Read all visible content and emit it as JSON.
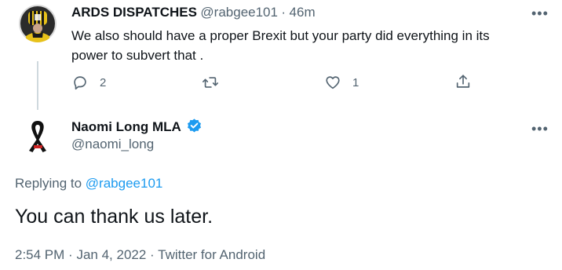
{
  "tweet1": {
    "name": "ARDS DISPATCHES",
    "handle": "@rabgee101",
    "separator": "·",
    "time": "46m",
    "text_line1": "We also should have a proper Brexit but your party did everything in its",
    "text_line2": "power to subvert that .",
    "reply_count": "2",
    "retweet_count": "",
    "like_count": "1",
    "more_icon": "more-horizontal-icon"
  },
  "tweet2": {
    "name": "Naomi Long MLA",
    "handle": "@naomi_long",
    "verified_icon": "verified-badge-icon",
    "verified_color": "#1d9bf0",
    "replying_prefix": "Replying to",
    "replying_to": "@rabgee101",
    "text": "You can thank us later.",
    "time": "2:54 PM",
    "date": "Jan 4, 2022",
    "client": "Twitter for Android",
    "separator": "·",
    "more_icon": "more-horizontal-icon"
  },
  "colors": {
    "text": "#0f1419",
    "secondary": "#536471",
    "accent": "#1d9bf0",
    "thread_line": "#cfd9de"
  }
}
